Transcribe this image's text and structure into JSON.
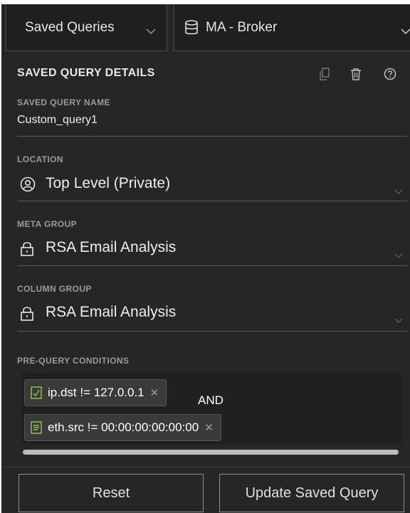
{
  "header": {
    "saved_queries_label": "Saved Queries",
    "service_label": "MA - Broker"
  },
  "details": {
    "title": "SAVED QUERY DETAILS",
    "name_label": "SAVED QUERY NAME",
    "name_value": "Custom_query1",
    "location_label": "LOCATION",
    "location_value": "Top Level (Private)",
    "meta_group_label": "META GROUP",
    "meta_group_value": "RSA Email Analysis",
    "column_group_label": "COLUMN GROUP",
    "column_group_value": "RSA Email Analysis",
    "prequery_label": "PRE-QUERY CONDITIONS"
  },
  "conditions": [
    {
      "text": "ip.dst != 127.0.0.1",
      "icon": "condition-icon"
    },
    {
      "text": "eth.src != 00:00:00:00:00:00",
      "icon": "condition-icon"
    }
  ],
  "operator": "AND",
  "buttons": {
    "reset": "Reset",
    "update": "Update Saved Query"
  },
  "colors": {
    "background": "#262626",
    "text": "#eeeeee",
    "label": "#9a9a9a",
    "accent_green": "#8bc34a"
  }
}
